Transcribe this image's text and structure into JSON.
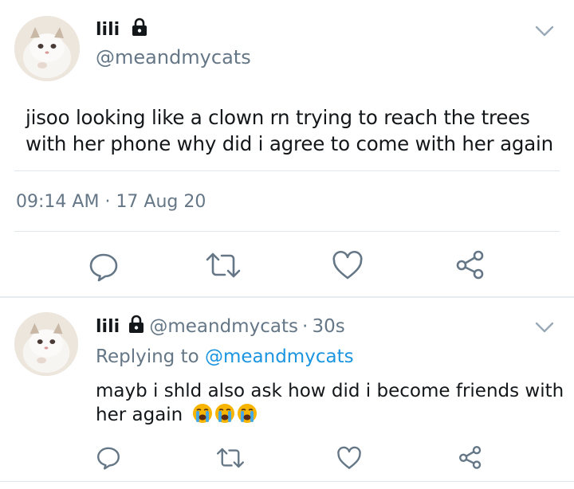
{
  "main_tweet": {
    "display_name": "lili",
    "handle": "@meandmycats",
    "text_line1": "jisoo looking like a clown rn trying to reach the trees",
    "text_line2": "with her phone why did i agree to come with her again",
    "time": "09:14 AM",
    "separator": "·",
    "date": "17 Aug 20"
  },
  "reply_tweet": {
    "display_name": "lili",
    "handle": "@meandmycats",
    "separator": "·",
    "age": "30s",
    "replying_prefix": "Replying to",
    "replying_handle": "@meandmycats",
    "text_line1": "mayb i shld also ask how did i become friends with",
    "text_line2": "her again",
    "emoji_count": 3
  },
  "icons": {
    "lock": "lock-icon",
    "chevron": "chevron-down-icon",
    "reply": "reply-icon",
    "retweet": "retweet-icon",
    "like": "heart-icon",
    "share": "share-icon",
    "crying": "loudly-crying-face-emoji"
  },
  "colors": {
    "text": "#14171a",
    "secondary": "#657786",
    "link": "#1b95e0",
    "icon": "#657786",
    "divider": "#e1e8ed",
    "emoji": "#f7b500"
  }
}
